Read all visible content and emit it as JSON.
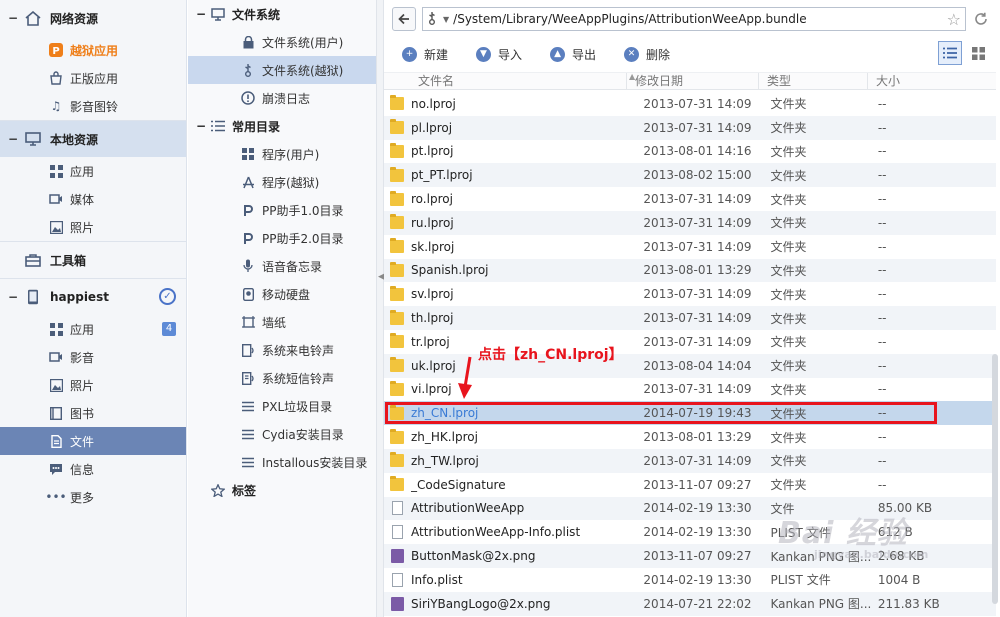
{
  "sidebar": {
    "groups": [
      {
        "label": "网络资源",
        "items": [
          {
            "label": "越狱应用",
            "highlight": true
          },
          {
            "label": "正版应用"
          },
          {
            "label": "影音图铃"
          }
        ]
      },
      {
        "label": "本地资源",
        "items": [
          {
            "label": "应用"
          },
          {
            "label": "媒体"
          },
          {
            "label": "照片"
          }
        ]
      },
      {
        "label": "工具箱",
        "items": []
      },
      {
        "label": "happiest",
        "items": [
          {
            "label": "应用",
            "badge": "4"
          },
          {
            "label": "影音"
          },
          {
            "label": "照片"
          },
          {
            "label": "图书"
          },
          {
            "label": "文件",
            "active": true
          },
          {
            "label": "信息"
          },
          {
            "label": "更多"
          }
        ]
      }
    ],
    "toggle_minus": "−"
  },
  "tree": {
    "filesystem": {
      "label": "文件系统",
      "items": [
        "文件系统(用户)",
        "文件系统(越狱)",
        "崩溃日志"
      ]
    },
    "common": {
      "label": "常用目录",
      "items": [
        "程序(用户)",
        "程序(越狱)",
        "PP助手1.0目录",
        "PP助手2.0目录",
        "语音备忘录",
        "移动硬盘",
        "墙纸",
        "系统来电铃声",
        "系统短信铃声",
        "PXL垃圾目录",
        "Cydia安装目录",
        "Installous安装目录"
      ]
    },
    "tags": {
      "label": "标签"
    }
  },
  "address": {
    "path": "/System/Library/WeeAppPlugins/AttributionWeeApp.bundle"
  },
  "toolbar": {
    "new": "新建",
    "import": "导入",
    "export": "导出",
    "delete": "删除"
  },
  "columns": {
    "name": "文件名",
    "date": "修改日期",
    "type": "类型",
    "size": "大小"
  },
  "files": [
    {
      "name": "no.lproj",
      "date": "2013-07-31 14:09",
      "type": "文件夹",
      "size": "--",
      "kind": "folder"
    },
    {
      "name": "pl.lproj",
      "date": "2013-07-31 14:09",
      "type": "文件夹",
      "size": "--",
      "kind": "folder"
    },
    {
      "name": "pt.lproj",
      "date": "2013-08-01 14:16",
      "type": "文件夹",
      "size": "--",
      "kind": "folder"
    },
    {
      "name": "pt_PT.lproj",
      "date": "2013-08-02 15:00",
      "type": "文件夹",
      "size": "--",
      "kind": "folder"
    },
    {
      "name": "ro.lproj",
      "date": "2013-07-31 14:09",
      "type": "文件夹",
      "size": "--",
      "kind": "folder"
    },
    {
      "name": "ru.lproj",
      "date": "2013-07-31 14:09",
      "type": "文件夹",
      "size": "--",
      "kind": "folder"
    },
    {
      "name": "sk.lproj",
      "date": "2013-07-31 14:09",
      "type": "文件夹",
      "size": "--",
      "kind": "folder"
    },
    {
      "name": "Spanish.lproj",
      "date": "2013-08-01 13:29",
      "type": "文件夹",
      "size": "--",
      "kind": "folder"
    },
    {
      "name": "sv.lproj",
      "date": "2013-07-31 14:09",
      "type": "文件夹",
      "size": "--",
      "kind": "folder"
    },
    {
      "name": "th.lproj",
      "date": "2013-07-31 14:09",
      "type": "文件夹",
      "size": "--",
      "kind": "folder"
    },
    {
      "name": "tr.lproj",
      "date": "2013-07-31 14:09",
      "type": "文件夹",
      "size": "--",
      "kind": "folder"
    },
    {
      "name": "uk.lproj",
      "date": "2013-08-04 14:04",
      "type": "文件夹",
      "size": "--",
      "kind": "folder"
    },
    {
      "name": "vi.lproj",
      "date": "2013-07-31 14:09",
      "type": "文件夹",
      "size": "--",
      "kind": "folder"
    },
    {
      "name": "zh_CN.lproj",
      "date": "2014-07-19 19:43",
      "type": "文件夹",
      "size": "--",
      "kind": "folder",
      "selected": true
    },
    {
      "name": "zh_HK.lproj",
      "date": "2013-08-01 13:29",
      "type": "文件夹",
      "size": "--",
      "kind": "folder"
    },
    {
      "name": "zh_TW.lproj",
      "date": "2013-07-31 14:09",
      "type": "文件夹",
      "size": "--",
      "kind": "folder"
    },
    {
      "name": "_CodeSignature",
      "date": "2013-11-07 09:27",
      "type": "文件夹",
      "size": "--",
      "kind": "folder"
    },
    {
      "name": "AttributionWeeApp",
      "date": "2014-02-19 13:30",
      "type": "文件",
      "size": "85.00 KB",
      "kind": "file"
    },
    {
      "name": "AttributionWeeApp-Info.plist",
      "date": "2014-02-19 13:30",
      "type": "PLIST 文件",
      "size": "612 B",
      "kind": "file"
    },
    {
      "name": "ButtonMask@2x.png",
      "date": "2013-11-07 09:27",
      "type": "Kankan PNG 图...",
      "size": "2.68 KB",
      "kind": "png"
    },
    {
      "name": "Info.plist",
      "date": "2014-02-19 13:30",
      "type": "PLIST 文件",
      "size": "1004 B",
      "kind": "file"
    },
    {
      "name": "SiriYBangLogo@2x.png",
      "date": "2014-07-21 22:02",
      "type": "Kankan PNG 图...",
      "size": "211.83 KB",
      "kind": "png"
    }
  ],
  "annotation": {
    "text": "点击【zh_CN.lproj】",
    "color": "#e8141d"
  },
  "watermark": {
    "text": "Bai 经验",
    "sub": "jingyan.baidu.com"
  },
  "colors": {
    "active_item": "#6b85b5",
    "highlight_item": "#ef7f1a",
    "selected_row": "#c4d7ec",
    "folder": "#f2c43d"
  }
}
